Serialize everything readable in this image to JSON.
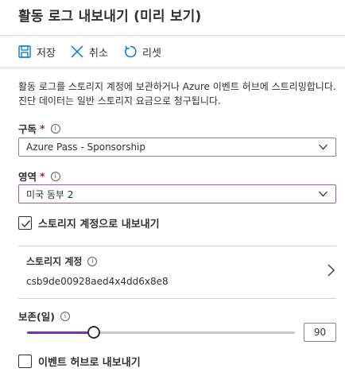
{
  "page": {
    "title": "활동 로그 내보내기 (미리 보기)"
  },
  "toolbar": {
    "save_label": "저장",
    "cancel_label": "취소",
    "reset_label": "리셋"
  },
  "description": "활동 로그를 스토리지 계정에 보관하거나 Azure 이벤트 허브에 스트리밍합니다. 진단 데이터는 일반 스토리지 요금으로 청구됩니다.",
  "subscription": {
    "label": "구독",
    "required_mark": "*",
    "value": "Azure Pass - Sponsorship"
  },
  "region": {
    "label": "영역",
    "required_mark": "*",
    "value": "미국 동부 2"
  },
  "export_storage": {
    "label": "스토리지 계정으로 내보내기",
    "checked": true
  },
  "storage_account": {
    "label": "스토리지 계정",
    "value": "csb9de00928aed4x4dd6x8e8"
  },
  "retention": {
    "label": "보존(일)",
    "value": "90",
    "fraction": 0.25
  },
  "export_eventhub": {
    "label": "이벤트 허브로 내보내기",
    "checked": false
  },
  "colors": {
    "accent": "#7b2fbf",
    "save_icon": "#0078d4",
    "required": "#a4262c"
  },
  "icons": {
    "save": "save-icon",
    "cancel": "close-icon",
    "reset": "reset-icon",
    "info": "info-icon",
    "chevron_down": "chevron-down-icon",
    "chevron_right": "chevron-right-icon",
    "check": "checkmark-icon"
  }
}
